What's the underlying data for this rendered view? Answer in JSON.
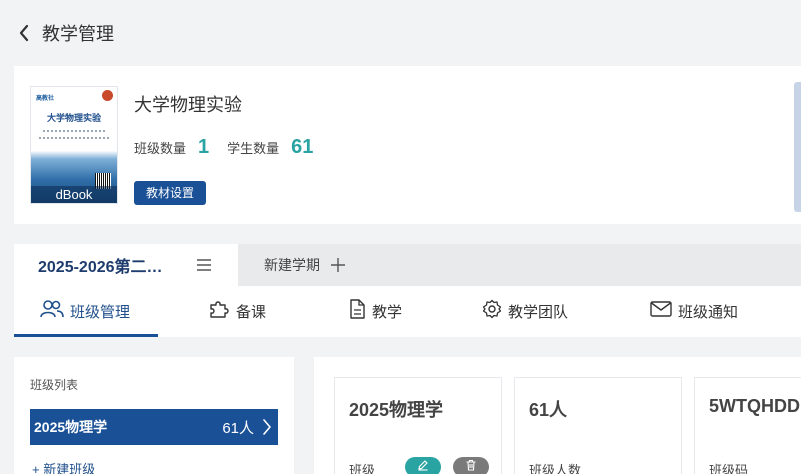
{
  "header": {
    "title": "教学管理",
    "back_icon": "chevron-left-icon"
  },
  "book": {
    "title": "大学物理实验",
    "cover": {
      "title": "大学物理实验",
      "brand": "dBook",
      "publisher_logo": "高教社"
    },
    "stats": [
      {
        "label": "班级数量",
        "value": "1"
      },
      {
        "label": "学生数量",
        "value": "61"
      }
    ],
    "settings_label": "教材设置"
  },
  "terms": {
    "active": "2025-2026第二…",
    "menu_icon": "list-icon",
    "new_label": "新建学期",
    "new_icon": "plus-icon"
  },
  "tabs": [
    {
      "label": "班级管理",
      "icon": "users-icon",
      "active": true
    },
    {
      "label": "备课",
      "icon": "puzzle-icon",
      "active": false
    },
    {
      "label": "教学",
      "icon": "document-icon",
      "active": false
    },
    {
      "label": "教学团队",
      "icon": "gear-icon",
      "active": false
    },
    {
      "label": "班级通知",
      "icon": "mail-icon",
      "active": false
    }
  ],
  "class_list": {
    "title": "班级列表",
    "items": [
      {
        "name": "2025物理学",
        "count": "61人"
      }
    ],
    "new_label": "+ 新建班级"
  },
  "class_info": {
    "cards": [
      {
        "value": "2025物理学",
        "label": "班级"
      },
      {
        "value": "61人",
        "label": "班级人数"
      },
      {
        "value": "5WTQHDD",
        "label": "班级码"
      }
    ],
    "edit_icon": "pencil-icon",
    "delete_icon": "trash-icon"
  },
  "colors": {
    "primary": "#1a5096",
    "accent": "#2aa3a3",
    "muted": "#7a7a7a",
    "background": "#f2f3f5"
  }
}
